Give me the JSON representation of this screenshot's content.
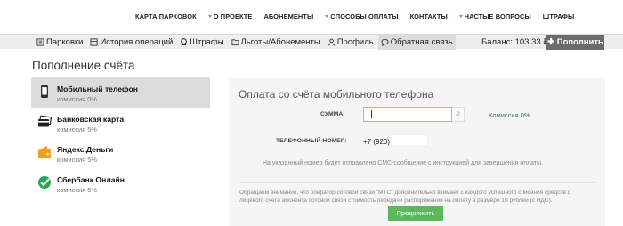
{
  "topnav": {
    "items": [
      {
        "label": "КАРТА ПАРКОВОК",
        "dropdown": false
      },
      {
        "label": "О ПРОЕКТЕ",
        "dropdown": true
      },
      {
        "label": "АБОНЕМЕНТЫ",
        "dropdown": false
      },
      {
        "label": "СПОСОБЫ ОПЛАТЫ",
        "dropdown": true
      },
      {
        "label": "КОНТАКТЫ",
        "dropdown": false
      },
      {
        "label": "ЧАСТЫЕ ВОПРОСЫ",
        "dropdown": true
      },
      {
        "label": "ШТРАФЫ",
        "dropdown": false
      }
    ]
  },
  "subbar": {
    "tabs": [
      {
        "label": "Парковки",
        "icon": "parking-icon"
      },
      {
        "label": "История операций",
        "icon": "history-icon"
      },
      {
        "label": "Штрафы",
        "icon": "fines-icon"
      },
      {
        "label": "Льготы/Абонементы",
        "icon": "folder-icon"
      },
      {
        "label": "Профиль",
        "icon": "user-icon"
      },
      {
        "label": "Обратная связь",
        "icon": "chat-icon"
      }
    ],
    "balance": "Баланс: 103.33 ₽",
    "topup_label": "✚ Пополнить"
  },
  "page_title": "Пополнение счёта",
  "methods": [
    {
      "name": "Мобильный телефон",
      "fee": "комиссия 0%",
      "icon": "mobile-phone-icon",
      "active": true
    },
    {
      "name": "Банковская карта",
      "fee": "комиссия 5%",
      "icon": "bank-card-icon",
      "active": false
    },
    {
      "name": "Яндекс.Деньги",
      "fee": "комиссия 5%",
      "icon": "yandex-money-icon",
      "active": false
    },
    {
      "name": "Сбербанк Онлайн",
      "fee": "комиссия 5%",
      "icon": "sberbank-icon",
      "active": false
    }
  ],
  "panel": {
    "title": "Оплата со счёта мобильного телефона",
    "amount_label": "СУММА:",
    "amount_value": "",
    "currency": "₽",
    "commission": "Комиссия 0%",
    "phone_label": "ТЕЛЕФОННЫЙ НОМЕР:",
    "phone_code": "+7 (920)",
    "phone_value": "",
    "sms_note": "На указанный номер будет отправлено СМС-сообщение с инструкцией для завершения оплаты.",
    "warning": "Обращаем внимание, что оператор сотовой связи \"МТС\" дополнительно взимает с каждого успешного списания средств с лицевого счета абонента сотовой связи стоимость передачи распоряжения на оплату в размере 10 рублей (с НДС).",
    "continue_label": "Продолжить"
  },
  "colors": {
    "accent": "#5cb85c",
    "link": "#2f6f7f",
    "topup_bg": "#6b6b6b"
  }
}
